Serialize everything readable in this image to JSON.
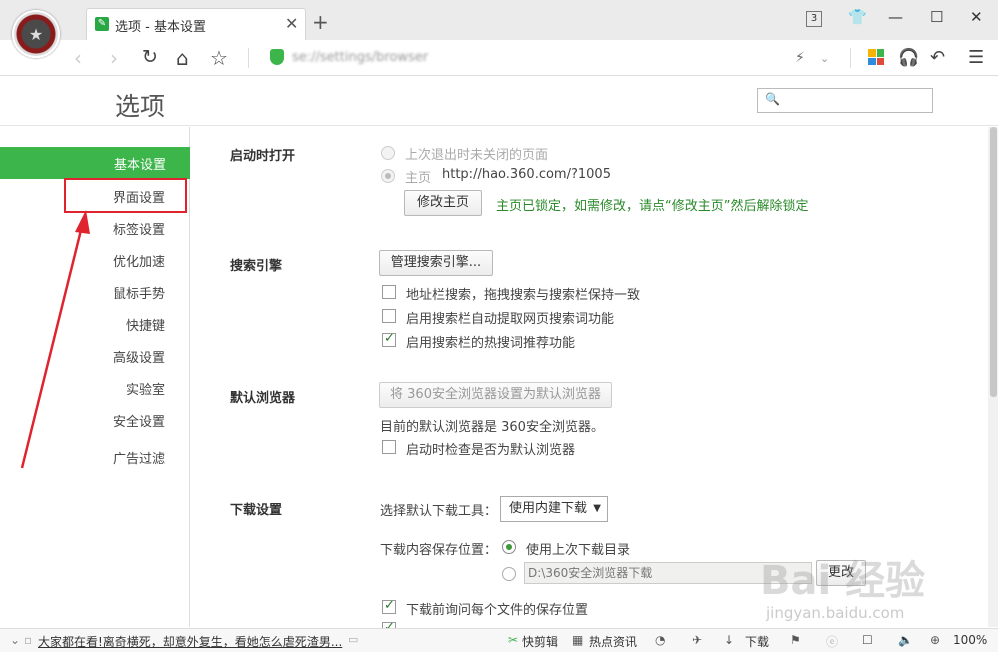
{
  "tab": {
    "title": "选项 - 基本设置",
    "count": "3"
  },
  "address": {
    "url": "se://settings/browser"
  },
  "header": {
    "title": "选项"
  },
  "sidebar": {
    "items": [
      {
        "label": "基本设置",
        "active": true
      },
      {
        "label": "界面设置"
      },
      {
        "label": "标签设置"
      },
      {
        "label": "优化加速"
      },
      {
        "label": "鼠标手势"
      },
      {
        "label": "快捷键"
      },
      {
        "label": "高级设置"
      },
      {
        "label": "实验室"
      },
      {
        "label": "安全设置"
      },
      {
        "label": "广告过滤"
      }
    ]
  },
  "startup": {
    "title": "启动时打开",
    "opt_last": "上次退出时未关闭的页面",
    "opt_home": "主页",
    "home_url": "http://hao.360.com/?1005",
    "edit_home": "修改主页",
    "locked_note": "主页已锁定，如需修改，请点“修改主页”然后解除锁定"
  },
  "search": {
    "title": "搜索引擎",
    "manage": "管理搜索引擎...",
    "opt1": "地址栏搜索，拖拽搜索与搜索栏保持一致",
    "opt2": "启用搜索栏自动提取网页搜索词功能",
    "opt3": "启用搜索栏的热搜词推荐功能"
  },
  "default_browser": {
    "title": "默认浏览器",
    "set_default": "将 360安全浏览器设置为默认浏览器",
    "current": "目前的默认浏览器是 360安全浏览器。",
    "check_startup": "启动时检查是否为默认浏览器"
  },
  "download": {
    "title": "下载设置",
    "tool_label": "选择默认下载工具：",
    "tool_value": "使用内建下载",
    "save_label": "下载内容保存位置：",
    "use_last": "使用上次下载目录",
    "path": "D:\\360安全浏览器下载",
    "browse": "更改",
    "ask_each": "下载前询问每个文件的保存位置"
  },
  "status": {
    "news": "大家都在看!离奇横死，却意外复生，看她怎么虐死渣男...",
    "cut": "快剪辑",
    "hot": "热点资讯",
    "download": "下载",
    "zoom": "100%"
  },
  "watermark": {
    "main": "Bai 经验",
    "sub": "jingyan.baidu.com"
  },
  "colors": {
    "accent": "#3cb54a",
    "highlight": "#e0242f"
  }
}
